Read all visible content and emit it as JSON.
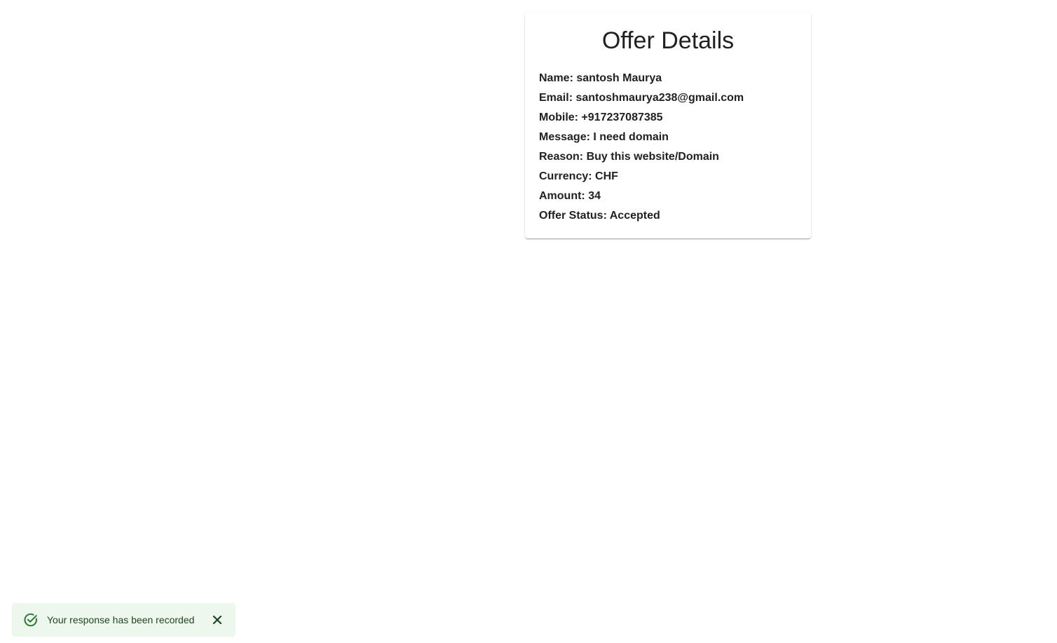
{
  "offer_card": {
    "title": "Offer Details",
    "details": [
      "Name: santosh Maurya",
      "Email: santoshmaurya238@gmail.com",
      "Mobile: +917237087385",
      "Message: I need domain",
      "Reason: Buy this website/Domain",
      "Currency: CHF",
      "Amount: 34",
      "Offer Status: Accepted"
    ]
  },
  "snackbar": {
    "message": "Your response has been recorded",
    "status_icon": "check-circle-icon",
    "close_icon": "close-icon",
    "background_color": "#edf7ed",
    "accent_color": "#2e7d32"
  }
}
